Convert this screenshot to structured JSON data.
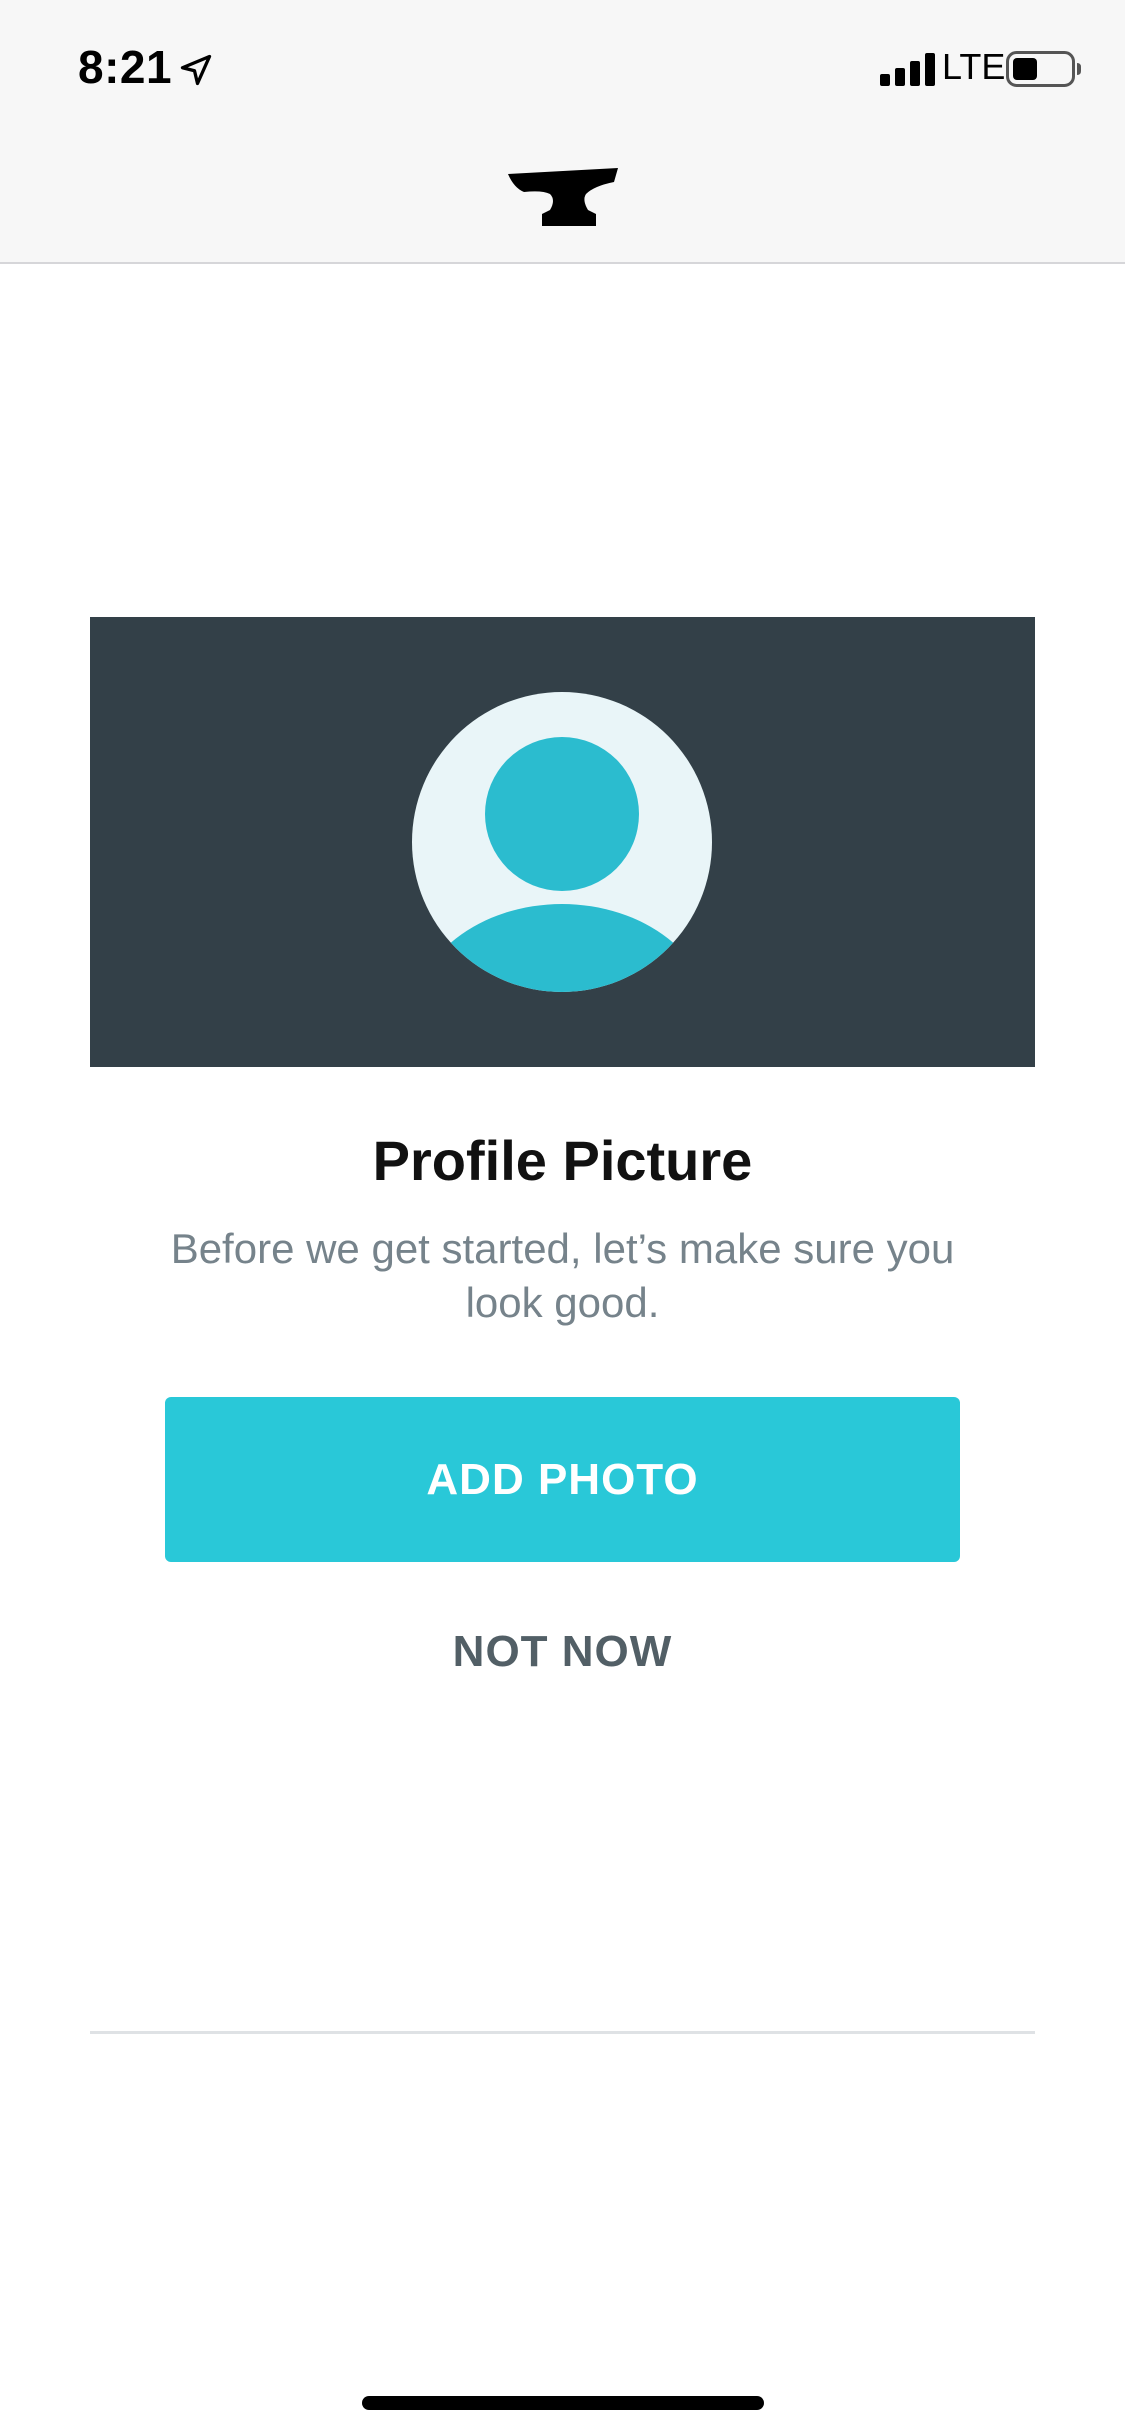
{
  "status_bar": {
    "time": "8:21",
    "network": "LTE",
    "icons": [
      "location-arrow-icon",
      "cellular-signal-icon",
      "battery-icon"
    ]
  },
  "nav_bar": {
    "logo": "anvil-logo-icon"
  },
  "hero": {
    "illustration": "avatar-placeholder-icon",
    "colors": {
      "background": "#334048",
      "circle": "#e9f5f8",
      "figure": "#2bbccf"
    }
  },
  "content": {
    "title": "Profile Picture",
    "subtitle": "Before we get started, let’s make sure you look good.",
    "primary_button": "ADD PHOTO",
    "secondary_button": "NOT NOW"
  },
  "colors": {
    "accent": "#29c8d8",
    "secondary_text": "#76838b",
    "secondary_button_text": "#525f66"
  }
}
